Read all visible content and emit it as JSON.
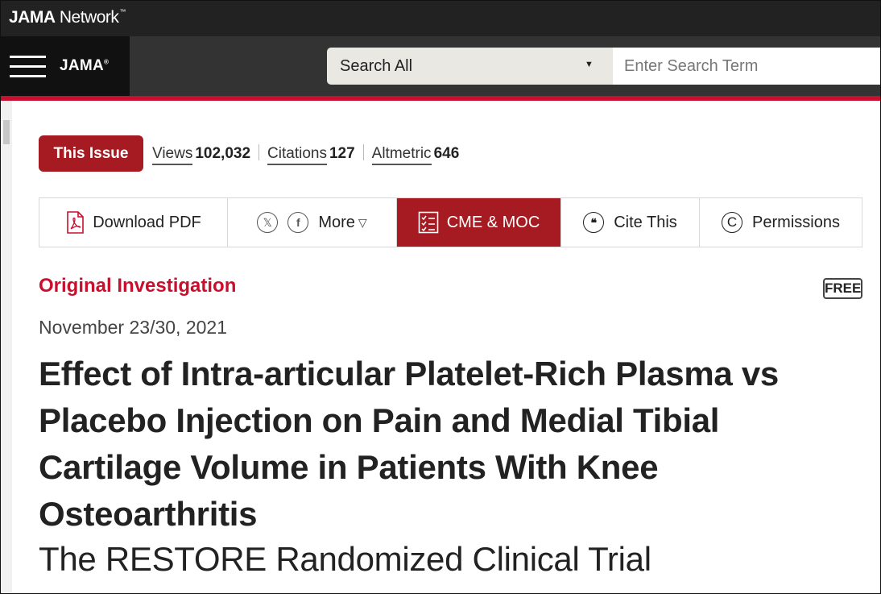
{
  "network": {
    "brand_bold": "JAMA",
    "brand_rest": " Network",
    "trademark": "™"
  },
  "header": {
    "logo": "JAMA",
    "logo_mark": "®",
    "search": {
      "scope": "Search All",
      "placeholder": "Enter Search Term"
    }
  },
  "metrics": {
    "issue_button": "This Issue",
    "views_label": "Views",
    "views_value": "102,032",
    "citations_label": "Citations",
    "citations_value": "127",
    "altmetric_label": "Altmetric",
    "altmetric_value": "646"
  },
  "toolbar": {
    "download_pdf": "Download PDF",
    "share_x_icon_glyph": "𝕏",
    "share_facebook_icon_glyph": "f",
    "more": "More",
    "cme_moc": "CME & MOC",
    "cite_this": "Cite This",
    "permissions": "Permissions"
  },
  "article": {
    "type": "Original Investigation",
    "access": "FREE",
    "date": "November 23/30, 2021",
    "title": "Effect of Intra-articular Platelet-Rich Plasma vs Placebo Injection on Pain and Medial Tibial Cartilage Volume in Patients With Knee Osteoarthritis",
    "subtitle": "The RESTORE Randomized Clinical Trial"
  },
  "colors": {
    "brand_red": "#a61b22",
    "accent_red": "#c8102e",
    "header_dark": "#222222"
  }
}
